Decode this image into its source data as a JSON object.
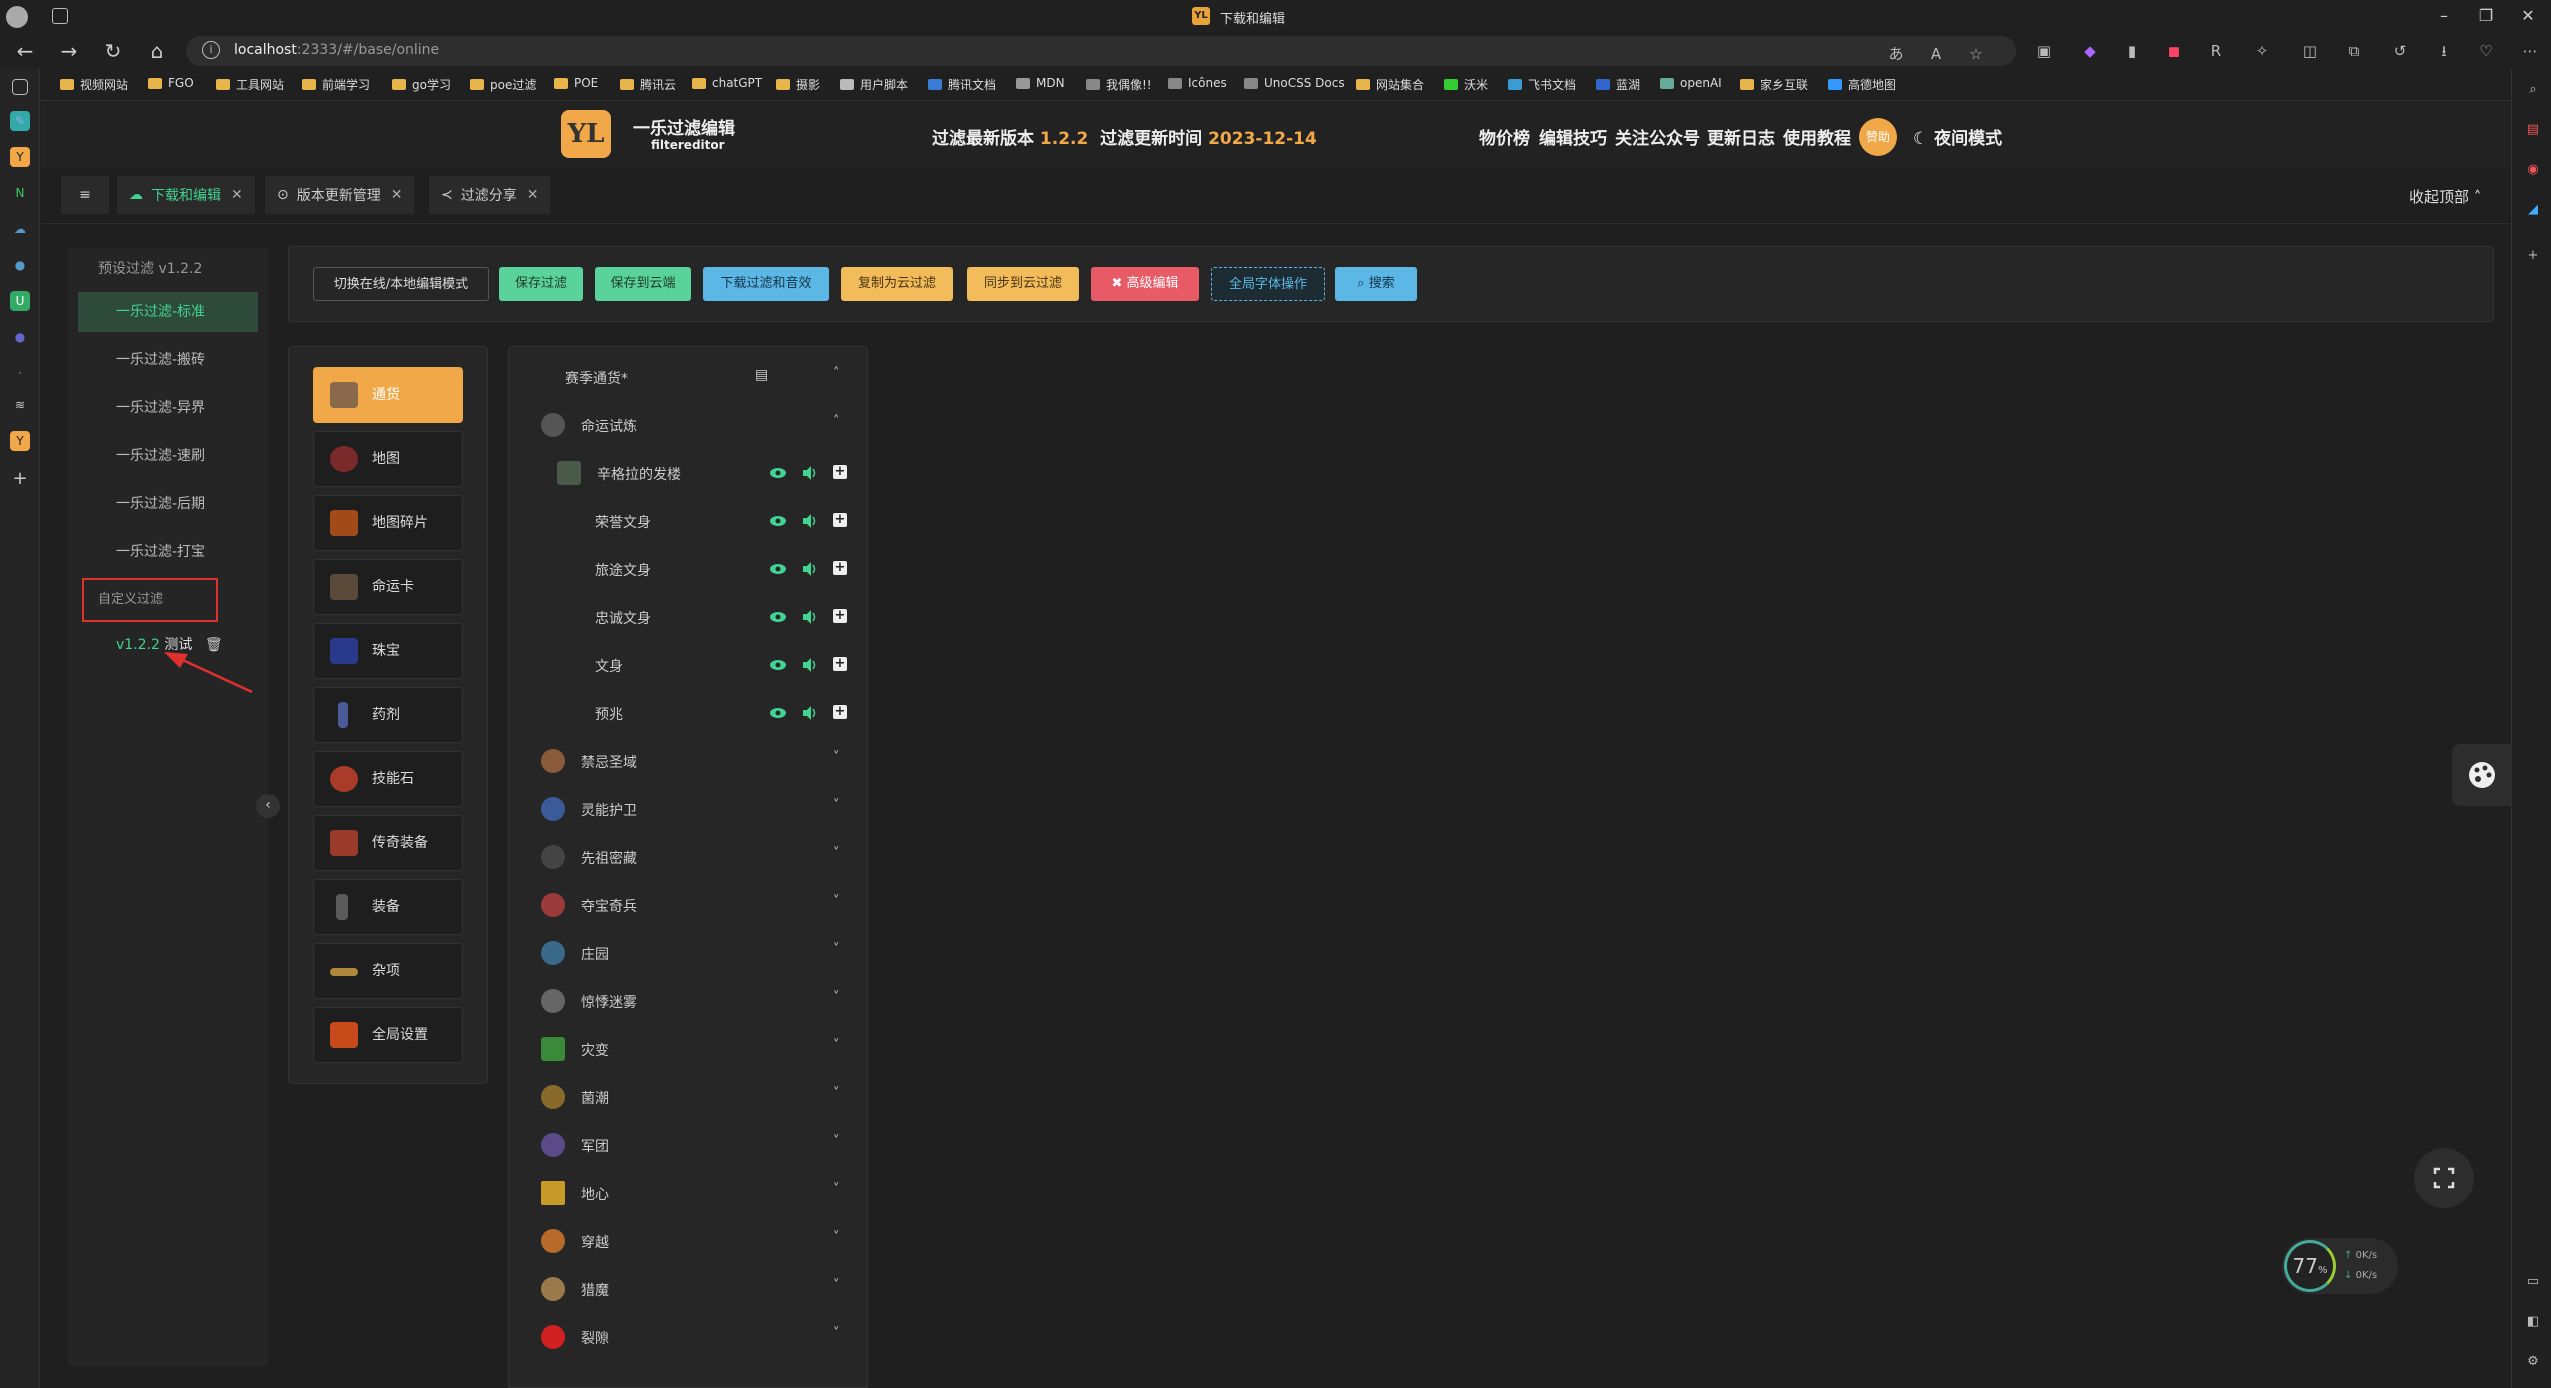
{
  "window": {
    "title": "下载和编辑"
  },
  "browser": {
    "url_host": "localhost",
    "url_rest": ":2333/#/base/online",
    "bookmarks": [
      "视频网站",
      "FGO",
      "工具网站",
      "前端学习",
      "go学习",
      "poe过滤",
      "POE",
      "腾讯云",
      "chatGPT",
      "摄影",
      "用户脚本",
      "腾讯文档",
      "MDN",
      "我偶像!!",
      "Icônes",
      "UnoCSS Docs",
      "网站集合",
      "沃米",
      "飞书文档",
      "蓝湖",
      "openAI",
      "家乡互联",
      "高德地图"
    ]
  },
  "header": {
    "logo_text": "YL",
    "brand": "一乐过滤编辑",
    "brand_sub": "filtereditor",
    "latest_label": "过滤最新版本",
    "latest_version": "1.2.2",
    "update_label": "过滤更新时间",
    "update_date": "2023-12-14",
    "nav": [
      "物价榜",
      "编辑技巧",
      "关注公众号",
      "更新日志",
      "使用教程"
    ],
    "avatar": "赞助",
    "night_mode": "夜间模式"
  },
  "tabs": [
    {
      "label": "下载和编辑",
      "active": true
    },
    {
      "label": "版本更新管理",
      "active": false
    },
    {
      "label": "过滤分享",
      "active": false
    }
  ],
  "collapse_top": "收起顶部",
  "presets": {
    "header": "预设过滤 v1.2.2",
    "items": [
      "一乐过滤-标准",
      "一乐过滤-搬砖",
      "一乐过滤-异界",
      "一乐过滤-速刷",
      "一乐过滤-后期",
      "一乐过滤-打宝"
    ],
    "custom_label": "自定义过滤",
    "custom_version": "v1.2.2",
    "custom_name": "测试"
  },
  "toolbar": {
    "buttons": [
      "切换在线/本地编辑模式",
      "保存过滤",
      "保存到云端",
      "下载过滤和音效",
      "复制为云过滤",
      "同步到云过滤",
      "高级编辑",
      "全局字体操作",
      "搜索"
    ]
  },
  "categories": [
    "通货",
    "地图",
    "地图碎片",
    "命运卡",
    "珠宝",
    "药剂",
    "技能石",
    "传奇装备",
    "装备",
    "杂项",
    "全局设置"
  ],
  "tree": {
    "season": "赛季通货*",
    "group": "命运试炼",
    "subgroup": "辛格拉的发楼",
    "leaves": [
      "荣誉文身",
      "旅途文身",
      "忠诚文身",
      "文身",
      "预兆"
    ],
    "sections": [
      "禁忌圣域",
      "灵能护卫",
      "先祖密藏",
      "夺宝奇兵",
      "庄园",
      "惊悸迷雾",
      "灾变",
      "菌潮",
      "军团",
      "地心",
      "穿越",
      "猎魔",
      "裂隙"
    ]
  },
  "network": {
    "cpu_percent": "77",
    "unit": "%",
    "up": "0K/s",
    "down": "0K/s"
  },
  "colors": {
    "accent_green": "#42d392",
    "accent_orange": "#f0a849",
    "btn_green": "#5ad39a",
    "btn_blue": "#5ab7e6",
    "btn_yellow": "#f2bc5a",
    "btn_red": "#e85a66"
  }
}
